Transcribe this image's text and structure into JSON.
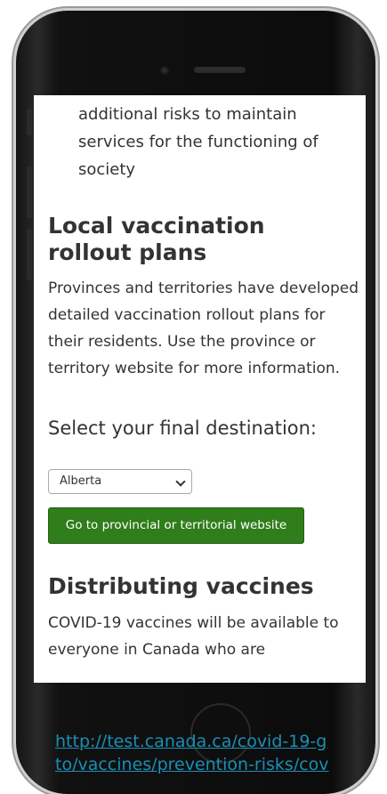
{
  "content": {
    "bullet_continuation": "additional risks to maintain services for the functioning of society",
    "local_heading": "Local vaccination rollout plans",
    "local_paragraph": "Provinces and territories have developed detailed vaccination rollout plans for their residents. Use the province or territory website for more information.",
    "select_label": "Select your final destination:",
    "select_value": "Alberta",
    "go_button": "Go to provincial or territorial website",
    "distributing_heading": "Distributing vaccines",
    "distributing_paragraph": "COVID-19 vaccines will be available to everyone in Canada who are"
  },
  "footer": {
    "url_line1": "http://test.canada.ca/covid-19-g",
    "url_line2": "to/vaccines/prevention-risks/cov"
  },
  "colors": {
    "button_green": "#2f7d1b",
    "link_blue": "#1a8fb5",
    "text": "#333333"
  }
}
